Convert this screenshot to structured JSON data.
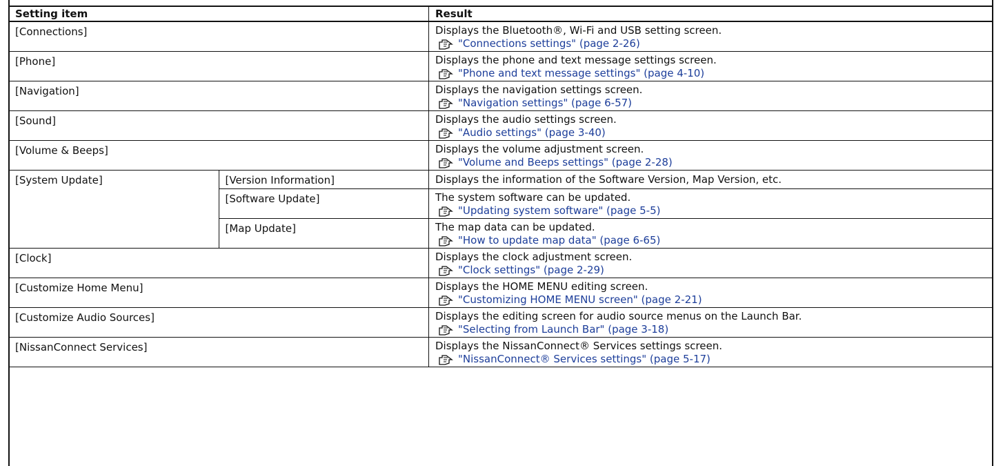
{
  "table": {
    "headers": {
      "setting": "Setting item",
      "result": "Result"
    },
    "rows": [
      {
        "item": "[Connections]",
        "result": "Displays the Bluetooth®, Wi-Fi and USB setting screen.",
        "ref": "\"Connections settings\" (page 2-26)"
      },
      {
        "item": "[Phone]",
        "result": "Displays the phone and text message settings screen.",
        "ref": "\"Phone and text message settings\" (page 4-10)"
      },
      {
        "item": "[Navigation]",
        "result": "Displays the navigation settings screen.",
        "ref": "\"Navigation settings\" (page 6-57)"
      },
      {
        "item": "[Sound]",
        "result": "Displays the audio settings screen.",
        "ref": "\"Audio settings\" (page 3-40)"
      },
      {
        "item": "[Volume & Beeps]",
        "result": "Displays the volume adjustment screen.",
        "ref": "\"Volume and Beeps settings\" (page 2-28)"
      },
      {
        "item": "[System Update]",
        "subitems": [
          {
            "item": "[Version Information]",
            "result": "Displays the information of the Software Version, Map Version, etc.",
            "ref": ""
          },
          {
            "item": "[Software Update]",
            "result": "The system software can be updated.",
            "ref": "\"Updating system software\" (page 5-5)"
          },
          {
            "item": "[Map Update]",
            "result": "The map data can be updated.",
            "ref": "\"How to update map data\" (page 6-65)"
          }
        ]
      },
      {
        "item": "[Clock]",
        "result": "Displays the clock adjustment screen.",
        "ref": "\"Clock settings\" (page 2-29)"
      },
      {
        "item": "[Customize Home Menu]",
        "result": "Displays the HOME MENU editing screen.",
        "ref": "\"Customizing HOME MENU screen\" (page 2-21)"
      },
      {
        "item": "[Customize Audio Sources]",
        "result": "Displays the editing screen for audio source menus on the Launch Bar.",
        "ref": "\"Selecting from Launch Bar\" (page 3-18)"
      },
      {
        "item": "[NissanConnect Services]",
        "result": "Displays the NissanConnect® Services settings screen.",
        "ref": "\"NissanConnect® Services settings\" (page 5-17)"
      }
    ]
  },
  "icons": {
    "ref": "reference-icon"
  },
  "colors": {
    "link": "#1d3e9a",
    "border": "#111111"
  }
}
